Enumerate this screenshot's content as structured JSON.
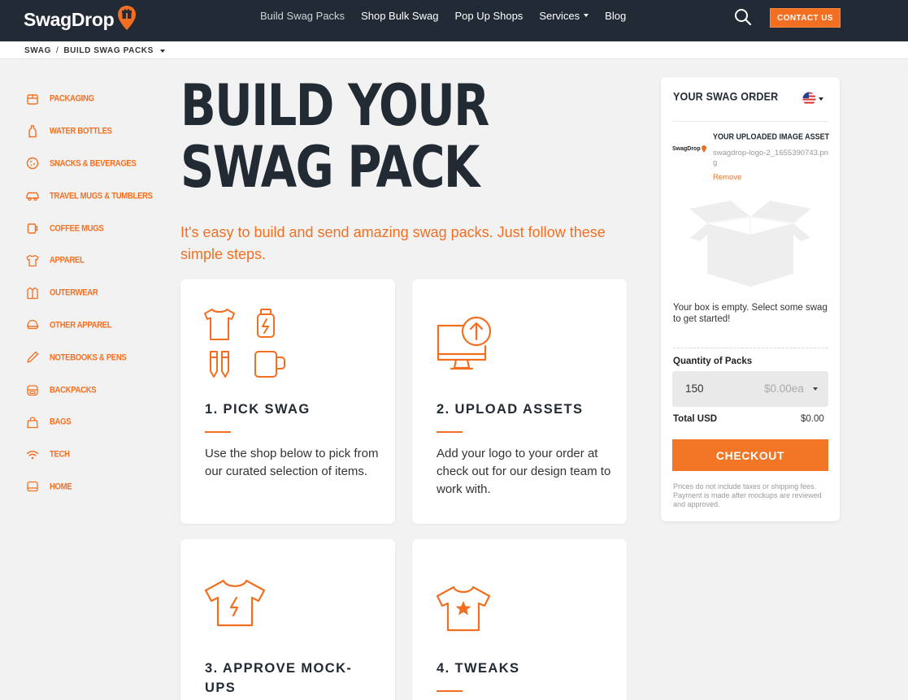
{
  "header": {
    "logo_text": "SwagDrop",
    "nav": [
      {
        "label": "Build Swag Packs"
      },
      {
        "label": "Shop Bulk Swag"
      },
      {
        "label": "Pop Up Shops"
      },
      {
        "label": "Services"
      },
      {
        "label": "Blog"
      }
    ],
    "contact_label": "CONTACT US"
  },
  "breadcrumb": {
    "root": "SWAG",
    "separator": "/",
    "current": "BUILD SWAG PACKS"
  },
  "sidebar": {
    "categories": [
      {
        "label": "Packaging",
        "icon": "box-icon"
      },
      {
        "label": "Water Bottles",
        "icon": "bottle-icon"
      },
      {
        "label": "Snacks & Beverages",
        "icon": "cookie-icon"
      },
      {
        "label": "Travel Mugs & Tumblers",
        "icon": "car-icon"
      },
      {
        "label": "Coffee Mugs",
        "icon": "mug-icon"
      },
      {
        "label": "Apparel",
        "icon": "shirt-icon"
      },
      {
        "label": "Outerwear",
        "icon": "jacket-icon"
      },
      {
        "label": "Other Apparel",
        "icon": "cap-icon"
      },
      {
        "label": "Notebooks & Pens",
        "icon": "pen-icon"
      },
      {
        "label": "Backpacks",
        "icon": "backpack-icon"
      },
      {
        "label": "Bags",
        "icon": "bag-icon"
      },
      {
        "label": "Tech",
        "icon": "wifi-icon"
      },
      {
        "label": "Home",
        "icon": "home-icon"
      }
    ]
  },
  "hero": {
    "title_line1": "BUILD YOUR",
    "title_line2": "SWAG PACK",
    "subtitle": "It's easy to build and send amazing swag packs. Just follow these simple steps."
  },
  "steps": [
    {
      "title": "1. PICK SWAG",
      "body": "Use the shop below to pick from our curated selection of items."
    },
    {
      "title": "2. UPLOAD ASSETS",
      "body": "Add your logo to your order at check out for our design team to work with."
    },
    {
      "title": "3. APPROVE MOCK-UPS",
      "body": ""
    },
    {
      "title": "4. TWEAKS",
      "body": ""
    }
  ],
  "order": {
    "title": "YOUR SWAG ORDER",
    "asset_thumb_text": "SwagDrop",
    "asset_title": "YOUR UPLOADED IMAGE ASSET",
    "asset_filename": "swagdrop-logo-2_1655390743.png",
    "remove_label": "Remove",
    "empty_message": "Your box is empty. Select some swag to get started!",
    "quantity_label": "Quantity of Packs",
    "quantity_value": "150",
    "price_each": "$0.00ea",
    "total_label": "Total USD",
    "total_value": "$0.00",
    "checkout_label": "CHECKOUT",
    "disclaimer": "Prices do not include taxes or shipping fees. Payment is made after mockups are reviewed and approved."
  },
  "colors": {
    "accent": "#f26f21",
    "header_bg": "#222a36",
    "page_bg": "#f2f2f2"
  }
}
